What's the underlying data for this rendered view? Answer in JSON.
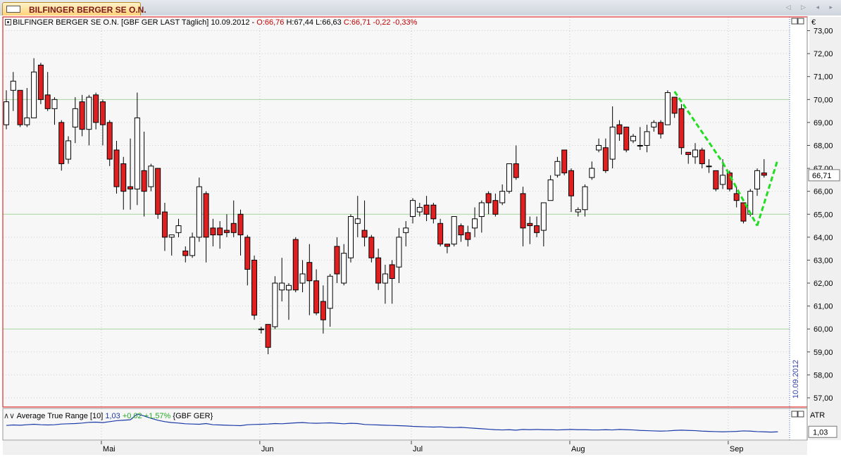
{
  "tab": {
    "title": "BILFINGER BERGER SE O.N.",
    "nav": "◁ ▷ ◂ ▸"
  },
  "header": {
    "name": "BILFINGER BERGER SE O.N.",
    "feed": "[GBF GER LAST Täglich]",
    "date": "10.09.2012",
    "open": "O:66,76",
    "high": "H:67,44",
    "low": "L:66,63",
    "close": "C:66,71",
    "change": "-0,22 -0,33%"
  },
  "indicator": {
    "name": "Average True Range [10]",
    "value": "1,03",
    "change": "+0,02 +1,57%",
    "symbol": "{GBF GER}",
    "axis_label": "ATR",
    "last_label": "1,03"
  },
  "price_axis": {
    "currency": "€",
    "last_label": "66,71"
  },
  "date_marker": "10.09.2012",
  "colors": {
    "up_fill": "#ffffff",
    "down_fill": "#e02020",
    "outline": "#000000",
    "grid_h": "#a8d8a0",
    "atr_line": "#1b3aa8",
    "trend": "#22dd22",
    "border": "#d40000"
  },
  "chart_data": {
    "type": "candlestick",
    "title": "BILFINGER BERGER SE O.N.",
    "ylim": [
      56.6,
      73.6
    ],
    "y_ticks": [
      "57,00",
      "58,00",
      "59,00",
      "60,00",
      "61,00",
      "62,00",
      "63,00",
      "64,00",
      "65,00",
      "66,00",
      "67,00",
      "68,00",
      "69,00",
      "70,00",
      "71,00",
      "72,00",
      "73,00"
    ],
    "x_ticks": [
      "Mai",
      "Jun",
      "Jul",
      "Aug",
      "Sep"
    ],
    "x_tick_index": [
      14,
      37,
      59,
      82,
      105
    ],
    "horizontal_lines": [
      70.0,
      65.0,
      60.0
    ],
    "candles": [
      {
        "o": 68.9,
        "h": 70.4,
        "l": 68.7,
        "c": 69.9
      },
      {
        "o": 70.4,
        "h": 71.2,
        "l": 69.5,
        "c": 70.8
      },
      {
        "o": 70.4,
        "h": 70.4,
        "l": 68.8,
        "c": 68.9
      },
      {
        "o": 68.9,
        "h": 70.5,
        "l": 68.8,
        "c": 69.2
      },
      {
        "o": 69.2,
        "h": 71.8,
        "l": 69.2,
        "c": 71.2
      },
      {
        "o": 71.5,
        "h": 71.6,
        "l": 69.8,
        "c": 70.0
      },
      {
        "o": 70.2,
        "h": 71.2,
        "l": 69.5,
        "c": 69.6
      },
      {
        "o": 69.6,
        "h": 70.1,
        "l": 68.9,
        "c": 70.0
      },
      {
        "o": 69.0,
        "h": 69.1,
        "l": 66.9,
        "c": 67.2
      },
      {
        "o": 67.4,
        "h": 68.4,
        "l": 67.2,
        "c": 68.2
      },
      {
        "o": 68.8,
        "h": 70.1,
        "l": 68.1,
        "c": 69.6
      },
      {
        "o": 69.9,
        "h": 70.2,
        "l": 68.4,
        "c": 68.7
      },
      {
        "o": 68.7,
        "h": 70.2,
        "l": 68.0,
        "c": 70.1
      },
      {
        "o": 70.2,
        "h": 70.3,
        "l": 68.7,
        "c": 69.0
      },
      {
        "o": 69.9,
        "h": 70.0,
        "l": 68.0,
        "c": 68.9
      },
      {
        "o": 69.0,
        "h": 69.1,
        "l": 67.1,
        "c": 67.4
      },
      {
        "o": 67.8,
        "h": 68.2,
        "l": 65.9,
        "c": 66.2
      },
      {
        "o": 67.2,
        "h": 67.5,
        "l": 65.2,
        "c": 66.0
      },
      {
        "o": 66.2,
        "h": 68.3,
        "l": 65.2,
        "c": 66.1
      },
      {
        "o": 66.1,
        "h": 70.3,
        "l": 65.4,
        "c": 69.2
      },
      {
        "o": 66.9,
        "h": 68.6,
        "l": 64.9,
        "c": 66.0
      },
      {
        "o": 66.2,
        "h": 67.2,
        "l": 66.0,
        "c": 67.1
      },
      {
        "o": 67.0,
        "h": 67.0,
        "l": 64.8,
        "c": 65.0
      },
      {
        "o": 65.1,
        "h": 65.5,
        "l": 63.4,
        "c": 64.0
      },
      {
        "o": 64.0,
        "h": 64.1,
        "l": 63.2,
        "c": 64.1
      },
      {
        "o": 64.2,
        "h": 64.8,
        "l": 64.0,
        "c": 64.5
      },
      {
        "o": 63.4,
        "h": 63.6,
        "l": 62.9,
        "c": 63.2
      },
      {
        "o": 63.2,
        "h": 64.2,
        "l": 63.1,
        "c": 64.0
      },
      {
        "o": 64.0,
        "h": 66.6,
        "l": 63.8,
        "c": 66.2
      },
      {
        "o": 65.9,
        "h": 66.0,
        "l": 62.9,
        "c": 64.0
      },
      {
        "o": 64.4,
        "h": 64.8,
        "l": 63.6,
        "c": 64.1
      },
      {
        "o": 64.4,
        "h": 64.7,
        "l": 63.5,
        "c": 64.1
      },
      {
        "o": 64.3,
        "h": 65.0,
        "l": 64.0,
        "c": 64.2
      },
      {
        "o": 64.6,
        "h": 65.6,
        "l": 64.0,
        "c": 64.2
      },
      {
        "o": 65.0,
        "h": 65.2,
        "l": 63.2,
        "c": 64.1
      },
      {
        "o": 64.0,
        "h": 64.1,
        "l": 61.9,
        "c": 62.6
      },
      {
        "o": 63.0,
        "h": 63.2,
        "l": 60.4,
        "c": 60.6
      },
      {
        "o": 60.0,
        "h": 60.1,
        "l": 59.8,
        "c": 60.0
      },
      {
        "o": 60.2,
        "h": 60.2,
        "l": 58.9,
        "c": 59.2
      },
      {
        "o": 60.1,
        "h": 62.3,
        "l": 60.0,
        "c": 62.0
      },
      {
        "o": 61.7,
        "h": 63.1,
        "l": 61.2,
        "c": 62.0
      },
      {
        "o": 61.7,
        "h": 62.0,
        "l": 60.4,
        "c": 61.9
      },
      {
        "o": 63.9,
        "h": 64.0,
        "l": 61.6,
        "c": 61.7
      },
      {
        "o": 62.0,
        "h": 63.0,
        "l": 61.6,
        "c": 62.4
      },
      {
        "o": 62.9,
        "h": 63.7,
        "l": 60.6,
        "c": 62.1
      },
      {
        "o": 62.1,
        "h": 62.6,
        "l": 60.6,
        "c": 60.7
      },
      {
        "o": 61.2,
        "h": 61.9,
        "l": 59.8,
        "c": 60.4
      },
      {
        "o": 60.9,
        "h": 62.4,
        "l": 60.1,
        "c": 62.3
      },
      {
        "o": 63.6,
        "h": 64.0,
        "l": 62.0,
        "c": 62.4
      },
      {
        "o": 62.0,
        "h": 63.7,
        "l": 61.9,
        "c": 63.3
      },
      {
        "o": 63.1,
        "h": 65.0,
        "l": 62.9,
        "c": 64.9
      },
      {
        "o": 64.6,
        "h": 65.8,
        "l": 64.0,
        "c": 64.8
      },
      {
        "o": 64.3,
        "h": 65.6,
        "l": 63.6,
        "c": 64.0
      },
      {
        "o": 64.0,
        "h": 64.1,
        "l": 62.9,
        "c": 63.1
      },
      {
        "o": 63.1,
        "h": 63.5,
        "l": 61.7,
        "c": 62.0
      },
      {
        "o": 62.0,
        "h": 62.8,
        "l": 61.1,
        "c": 62.4
      },
      {
        "o": 62.8,
        "h": 63.0,
        "l": 61.1,
        "c": 62.2
      },
      {
        "o": 62.7,
        "h": 64.4,
        "l": 62.0,
        "c": 64.0
      },
      {
        "o": 64.2,
        "h": 64.7,
        "l": 63.6,
        "c": 64.4
      },
      {
        "o": 64.9,
        "h": 65.7,
        "l": 64.6,
        "c": 65.6
      },
      {
        "o": 65.1,
        "h": 65.5,
        "l": 64.9,
        "c": 65.3
      },
      {
        "o": 65.4,
        "h": 65.8,
        "l": 64.7,
        "c": 65.0
      },
      {
        "o": 65.4,
        "h": 65.5,
        "l": 64.6,
        "c": 64.8
      },
      {
        "o": 64.6,
        "h": 64.8,
        "l": 63.6,
        "c": 63.7
      },
      {
        "o": 63.7,
        "h": 63.7,
        "l": 63.3,
        "c": 63.6
      },
      {
        "o": 63.7,
        "h": 64.9,
        "l": 63.6,
        "c": 64.9
      },
      {
        "o": 64.5,
        "h": 64.6,
        "l": 63.8,
        "c": 64.1
      },
      {
        "o": 64.2,
        "h": 64.5,
        "l": 63.6,
        "c": 63.9
      },
      {
        "o": 64.4,
        "h": 65.3,
        "l": 64.0,
        "c": 64.8
      },
      {
        "o": 64.9,
        "h": 65.6,
        "l": 64.2,
        "c": 65.5
      },
      {
        "o": 65.9,
        "h": 66.0,
        "l": 65.0,
        "c": 65.5
      },
      {
        "o": 65.6,
        "h": 65.9,
        "l": 64.9,
        "c": 65.0
      },
      {
        "o": 65.5,
        "h": 66.3,
        "l": 65.4,
        "c": 66.0
      },
      {
        "o": 66.0,
        "h": 67.2,
        "l": 65.9,
        "c": 67.2
      },
      {
        "o": 67.2,
        "h": 68.0,
        "l": 66.5,
        "c": 66.6
      },
      {
        "o": 65.9,
        "h": 66.2,
        "l": 63.6,
        "c": 64.4
      },
      {
        "o": 64.6,
        "h": 64.9,
        "l": 63.7,
        "c": 64.5
      },
      {
        "o": 64.5,
        "h": 64.9,
        "l": 64.0,
        "c": 64.2
      },
      {
        "o": 64.3,
        "h": 65.4,
        "l": 63.6,
        "c": 65.5
      },
      {
        "o": 65.6,
        "h": 66.7,
        "l": 65.6,
        "c": 66.5
      },
      {
        "o": 66.7,
        "h": 67.5,
        "l": 66.6,
        "c": 67.3
      },
      {
        "o": 67.8,
        "h": 67.8,
        "l": 66.7,
        "c": 66.8
      },
      {
        "o": 66.9,
        "h": 67.0,
        "l": 65.1,
        "c": 65.8
      },
      {
        "o": 65.1,
        "h": 65.3,
        "l": 64.9,
        "c": 65.2
      },
      {
        "o": 65.2,
        "h": 66.3,
        "l": 64.9,
        "c": 66.2
      },
      {
        "o": 66.6,
        "h": 67.3,
        "l": 66.5,
        "c": 67.0
      },
      {
        "o": 67.8,
        "h": 68.3,
        "l": 67.7,
        "c": 68.0
      },
      {
        "o": 67.9,
        "h": 68.3,
        "l": 66.8,
        "c": 66.9
      },
      {
        "o": 67.4,
        "h": 69.7,
        "l": 67.0,
        "c": 68.8
      },
      {
        "o": 68.9,
        "h": 69.1,
        "l": 68.2,
        "c": 68.5
      },
      {
        "o": 68.8,
        "h": 68.8,
        "l": 67.7,
        "c": 67.8
      },
      {
        "o": 68.2,
        "h": 68.5,
        "l": 68.1,
        "c": 68.4
      },
      {
        "o": 68.0,
        "h": 68.8,
        "l": 67.8,
        "c": 68.0
      },
      {
        "o": 68.0,
        "h": 68.9,
        "l": 67.7,
        "c": 68.6
      },
      {
        "o": 68.8,
        "h": 69.1,
        "l": 68.6,
        "c": 69.0
      },
      {
        "o": 69.0,
        "h": 69.1,
        "l": 68.3,
        "c": 68.5
      },
      {
        "o": 68.9,
        "h": 70.4,
        "l": 68.9,
        "c": 70.3
      },
      {
        "o": 70.1,
        "h": 70.1,
        "l": 69.2,
        "c": 69.4
      },
      {
        "o": 69.6,
        "h": 69.8,
        "l": 67.6,
        "c": 67.9
      },
      {
        "o": 67.7,
        "h": 67.7,
        "l": 67.2,
        "c": 67.6
      },
      {
        "o": 67.5,
        "h": 68.1,
        "l": 67.2,
        "c": 67.8
      },
      {
        "o": 67.8,
        "h": 67.9,
        "l": 67.0,
        "c": 67.2
      },
      {
        "o": 67.1,
        "h": 67.4,
        "l": 66.8,
        "c": 67.1
      },
      {
        "o": 66.9,
        "h": 66.9,
        "l": 66.0,
        "c": 66.1
      },
      {
        "o": 66.3,
        "h": 67.4,
        "l": 66.1,
        "c": 66.7
      },
      {
        "o": 66.8,
        "h": 66.9,
        "l": 66.0,
        "c": 66.1
      },
      {
        "o": 65.9,
        "h": 66.2,
        "l": 65.3,
        "c": 65.6
      },
      {
        "o": 65.5,
        "h": 65.5,
        "l": 64.6,
        "c": 64.7
      },
      {
        "o": 65.0,
        "h": 66.1,
        "l": 64.9,
        "c": 66.0
      },
      {
        "o": 66.1,
        "h": 67.0,
        "l": 65.8,
        "c": 66.9
      },
      {
        "o": 66.8,
        "h": 67.4,
        "l": 66.6,
        "c": 66.7
      }
    ],
    "trend_segments": [
      [
        [
          97,
          70.35
        ],
        [
          104,
          67.25
        ]
      ],
      [
        [
          104,
          67.25
        ],
        [
          109,
          64.5
        ]
      ],
      [
        [
          109,
          64.5
        ],
        [
          112,
          67.4
        ]
      ]
    ],
    "atr": {
      "name": "Average True Range [10]",
      "values": [
        1.3,
        1.32,
        1.31,
        1.33,
        1.35,
        1.33,
        1.32,
        1.33,
        1.36,
        1.37,
        1.38,
        1.4,
        1.43,
        1.44,
        1.42,
        1.46,
        1.5,
        1.52,
        1.54,
        1.78,
        1.7,
        1.6,
        1.52,
        1.46,
        1.42,
        1.4,
        1.37,
        1.36,
        1.35,
        1.38,
        1.33,
        1.32,
        1.31,
        1.3,
        1.29,
        1.33,
        1.34,
        1.35,
        1.36,
        1.38,
        1.37,
        1.39,
        1.41,
        1.42,
        1.4,
        1.39,
        1.4,
        1.41,
        1.39,
        1.37,
        1.39,
        1.38,
        1.34,
        1.33,
        1.32,
        1.31,
        1.3,
        1.29,
        1.28,
        1.26,
        1.25,
        1.24,
        1.23,
        1.24,
        1.22,
        1.21,
        1.22,
        1.2,
        1.18,
        1.16,
        1.14,
        1.12,
        1.11,
        1.12,
        1.1,
        1.13,
        1.12,
        1.13,
        1.12,
        1.12,
        1.11,
        1.12,
        1.13,
        1.12,
        1.12,
        1.11,
        1.11,
        1.12,
        1.11,
        1.13,
        1.12,
        1.11,
        1.09,
        1.08,
        1.07,
        1.06,
        1.07,
        1.09,
        1.1,
        1.09,
        1.08,
        1.06,
        1.05,
        1.04,
        1.03,
        1.04,
        1.05,
        1.07,
        1.06,
        1.04,
        1.03,
        1.02,
        1.03
      ],
      "ylim": [
        0.8,
        1.9
      ]
    }
  }
}
